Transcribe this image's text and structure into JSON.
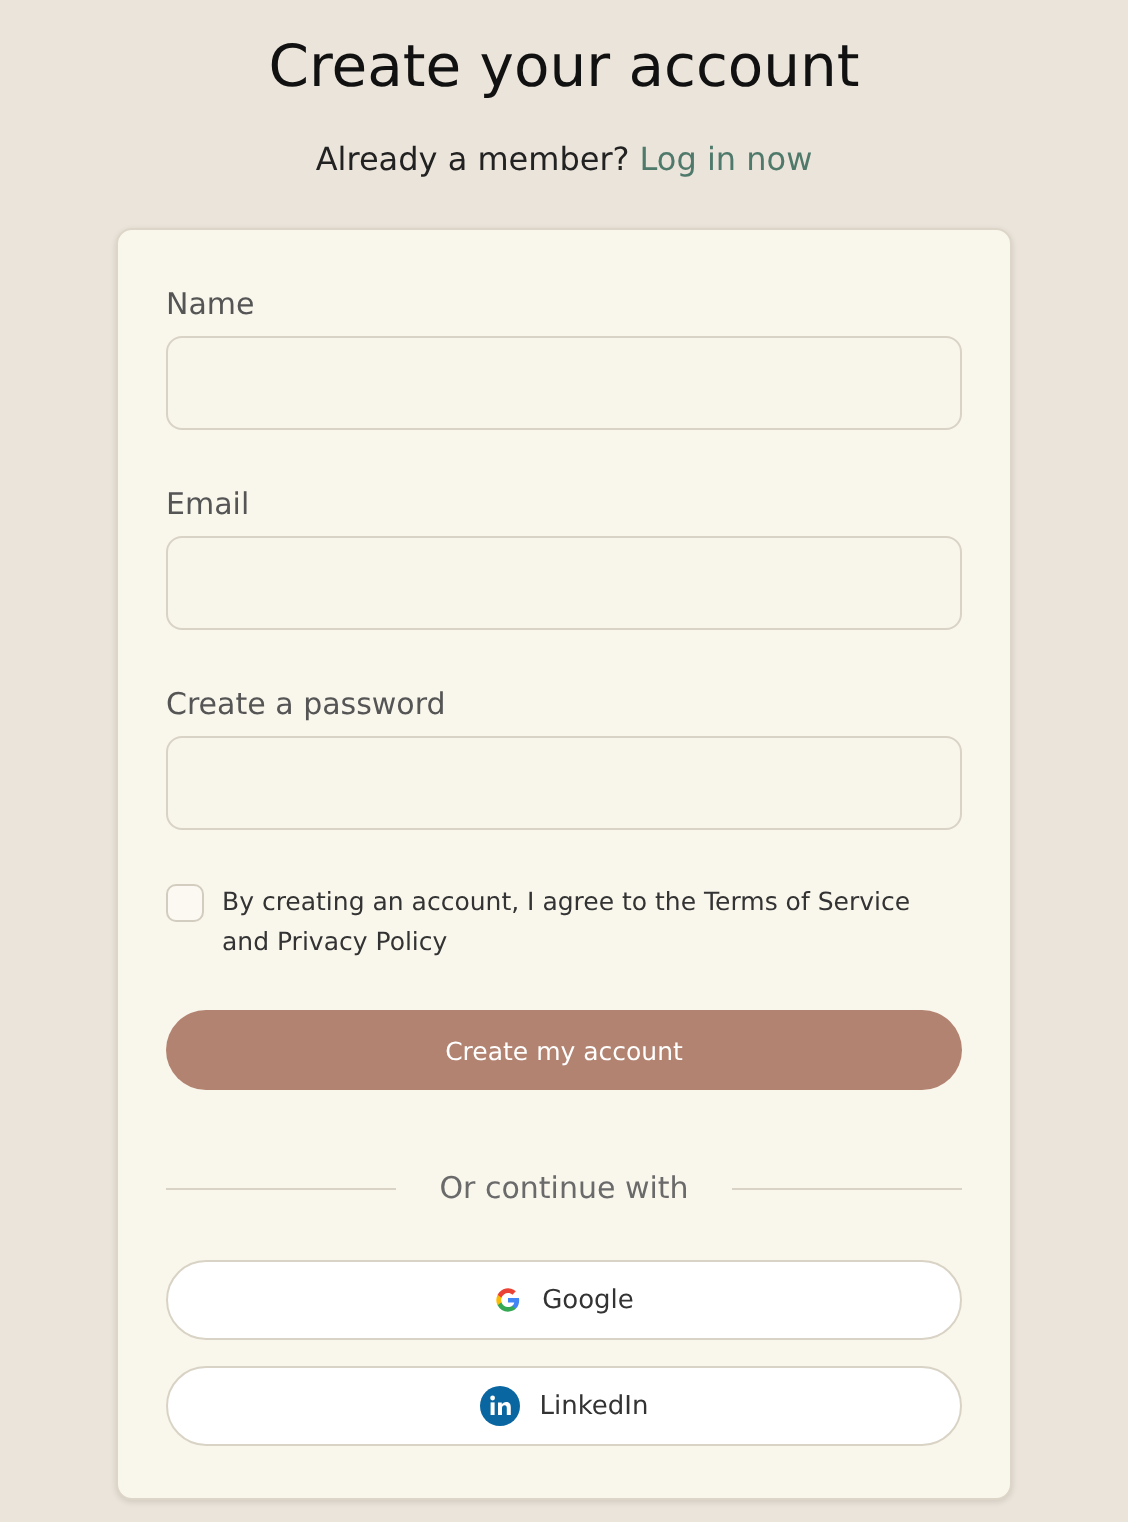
{
  "heading": {
    "title": "Create your account",
    "prompt": "Already a member?",
    "login_link": "Log in now"
  },
  "fields": [
    {
      "label": "Name"
    },
    {
      "label": "Email"
    },
    {
      "label": "Create a password"
    }
  ],
  "agreement": {
    "text": "By creating an account, I agree to the Terms of Service and Privacy Policy",
    "checked": false
  },
  "submit_button": "Create my account",
  "divider": "Or continue with",
  "social_buttons": [
    {
      "kind": "google",
      "label": "Google"
    },
    {
      "kind": "linkedin",
      "label": "LinkedIn"
    }
  ]
}
